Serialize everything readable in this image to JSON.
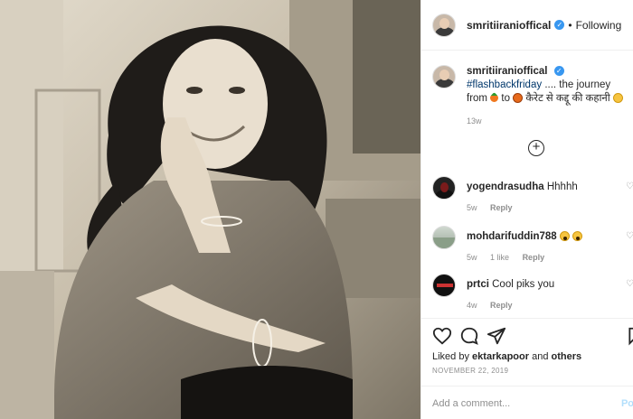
{
  "header": {
    "username": "smritiiranioffical",
    "separator": "•",
    "follow_status": "Following"
  },
  "caption": {
    "username": "smritiiranioffical",
    "hashtag": "#flashbackfriday",
    "text_part1": ".... the journey from",
    "text_part2": "to",
    "text_part3": "कैरेट से कद्दू की कहानी",
    "time": "13w"
  },
  "comments": [
    {
      "username": "yogendrasudha",
      "text": "Hhhhh",
      "time": "5w",
      "likes": "",
      "reply": "Reply"
    },
    {
      "username": "mohdarifuddin788",
      "text": "",
      "time": "5w",
      "likes": "1 like",
      "reply": "Reply"
    },
    {
      "username": "prtci",
      "text": "Cool piks you",
      "time": "4w",
      "likes": "",
      "reply": "Reply"
    }
  ],
  "likes": {
    "prefix": "Liked by",
    "user": "ektarkapoor",
    "and": "and",
    "others": "others"
  },
  "date": "NOVEMBER 22, 2019",
  "add_comment": {
    "placeholder": "Add a comment...",
    "post_label": "Po"
  },
  "icons": {
    "verified": "verified-badge-icon",
    "load_more": "plus-circle-icon",
    "like": "heart-icon",
    "comment": "comment-icon",
    "share": "share-icon",
    "save": "bookmark-icon"
  },
  "colors": {
    "verified": "#3897f0",
    "hashtag": "#00376b",
    "muted": "#8e8e8e",
    "post_disabled": "#b2dffc"
  }
}
